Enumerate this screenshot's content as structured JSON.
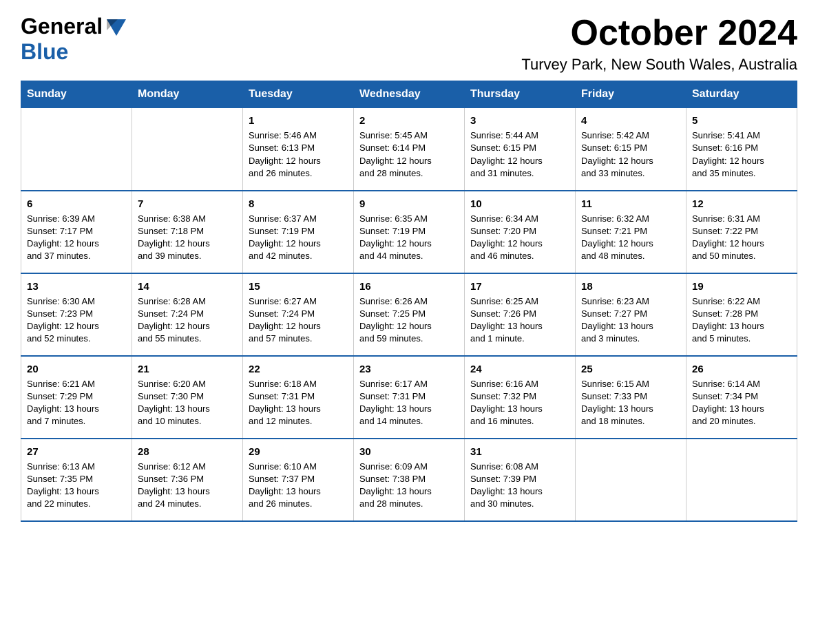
{
  "header": {
    "logo_general": "General",
    "logo_blue": "Blue",
    "month": "October 2024",
    "location": "Turvey Park, New South Wales, Australia"
  },
  "days_of_week": [
    "Sunday",
    "Monday",
    "Tuesday",
    "Wednesday",
    "Thursday",
    "Friday",
    "Saturday"
  ],
  "weeks": [
    [
      {
        "day": "",
        "info": ""
      },
      {
        "day": "",
        "info": ""
      },
      {
        "day": "1",
        "info": "Sunrise: 5:46 AM\nSunset: 6:13 PM\nDaylight: 12 hours\nand 26 minutes."
      },
      {
        "day": "2",
        "info": "Sunrise: 5:45 AM\nSunset: 6:14 PM\nDaylight: 12 hours\nand 28 minutes."
      },
      {
        "day": "3",
        "info": "Sunrise: 5:44 AM\nSunset: 6:15 PM\nDaylight: 12 hours\nand 31 minutes."
      },
      {
        "day": "4",
        "info": "Sunrise: 5:42 AM\nSunset: 6:15 PM\nDaylight: 12 hours\nand 33 minutes."
      },
      {
        "day": "5",
        "info": "Sunrise: 5:41 AM\nSunset: 6:16 PM\nDaylight: 12 hours\nand 35 minutes."
      }
    ],
    [
      {
        "day": "6",
        "info": "Sunrise: 6:39 AM\nSunset: 7:17 PM\nDaylight: 12 hours\nand 37 minutes."
      },
      {
        "day": "7",
        "info": "Sunrise: 6:38 AM\nSunset: 7:18 PM\nDaylight: 12 hours\nand 39 minutes."
      },
      {
        "day": "8",
        "info": "Sunrise: 6:37 AM\nSunset: 7:19 PM\nDaylight: 12 hours\nand 42 minutes."
      },
      {
        "day": "9",
        "info": "Sunrise: 6:35 AM\nSunset: 7:19 PM\nDaylight: 12 hours\nand 44 minutes."
      },
      {
        "day": "10",
        "info": "Sunrise: 6:34 AM\nSunset: 7:20 PM\nDaylight: 12 hours\nand 46 minutes."
      },
      {
        "day": "11",
        "info": "Sunrise: 6:32 AM\nSunset: 7:21 PM\nDaylight: 12 hours\nand 48 minutes."
      },
      {
        "day": "12",
        "info": "Sunrise: 6:31 AM\nSunset: 7:22 PM\nDaylight: 12 hours\nand 50 minutes."
      }
    ],
    [
      {
        "day": "13",
        "info": "Sunrise: 6:30 AM\nSunset: 7:23 PM\nDaylight: 12 hours\nand 52 minutes."
      },
      {
        "day": "14",
        "info": "Sunrise: 6:28 AM\nSunset: 7:24 PM\nDaylight: 12 hours\nand 55 minutes."
      },
      {
        "day": "15",
        "info": "Sunrise: 6:27 AM\nSunset: 7:24 PM\nDaylight: 12 hours\nand 57 minutes."
      },
      {
        "day": "16",
        "info": "Sunrise: 6:26 AM\nSunset: 7:25 PM\nDaylight: 12 hours\nand 59 minutes."
      },
      {
        "day": "17",
        "info": "Sunrise: 6:25 AM\nSunset: 7:26 PM\nDaylight: 13 hours\nand 1 minute."
      },
      {
        "day": "18",
        "info": "Sunrise: 6:23 AM\nSunset: 7:27 PM\nDaylight: 13 hours\nand 3 minutes."
      },
      {
        "day": "19",
        "info": "Sunrise: 6:22 AM\nSunset: 7:28 PM\nDaylight: 13 hours\nand 5 minutes."
      }
    ],
    [
      {
        "day": "20",
        "info": "Sunrise: 6:21 AM\nSunset: 7:29 PM\nDaylight: 13 hours\nand 7 minutes."
      },
      {
        "day": "21",
        "info": "Sunrise: 6:20 AM\nSunset: 7:30 PM\nDaylight: 13 hours\nand 10 minutes."
      },
      {
        "day": "22",
        "info": "Sunrise: 6:18 AM\nSunset: 7:31 PM\nDaylight: 13 hours\nand 12 minutes."
      },
      {
        "day": "23",
        "info": "Sunrise: 6:17 AM\nSunset: 7:31 PM\nDaylight: 13 hours\nand 14 minutes."
      },
      {
        "day": "24",
        "info": "Sunrise: 6:16 AM\nSunset: 7:32 PM\nDaylight: 13 hours\nand 16 minutes."
      },
      {
        "day": "25",
        "info": "Sunrise: 6:15 AM\nSunset: 7:33 PM\nDaylight: 13 hours\nand 18 minutes."
      },
      {
        "day": "26",
        "info": "Sunrise: 6:14 AM\nSunset: 7:34 PM\nDaylight: 13 hours\nand 20 minutes."
      }
    ],
    [
      {
        "day": "27",
        "info": "Sunrise: 6:13 AM\nSunset: 7:35 PM\nDaylight: 13 hours\nand 22 minutes."
      },
      {
        "day": "28",
        "info": "Sunrise: 6:12 AM\nSunset: 7:36 PM\nDaylight: 13 hours\nand 24 minutes."
      },
      {
        "day": "29",
        "info": "Sunrise: 6:10 AM\nSunset: 7:37 PM\nDaylight: 13 hours\nand 26 minutes."
      },
      {
        "day": "30",
        "info": "Sunrise: 6:09 AM\nSunset: 7:38 PM\nDaylight: 13 hours\nand 28 minutes."
      },
      {
        "day": "31",
        "info": "Sunrise: 6:08 AM\nSunset: 7:39 PM\nDaylight: 13 hours\nand 30 minutes."
      },
      {
        "day": "",
        "info": ""
      },
      {
        "day": "",
        "info": ""
      }
    ]
  ]
}
